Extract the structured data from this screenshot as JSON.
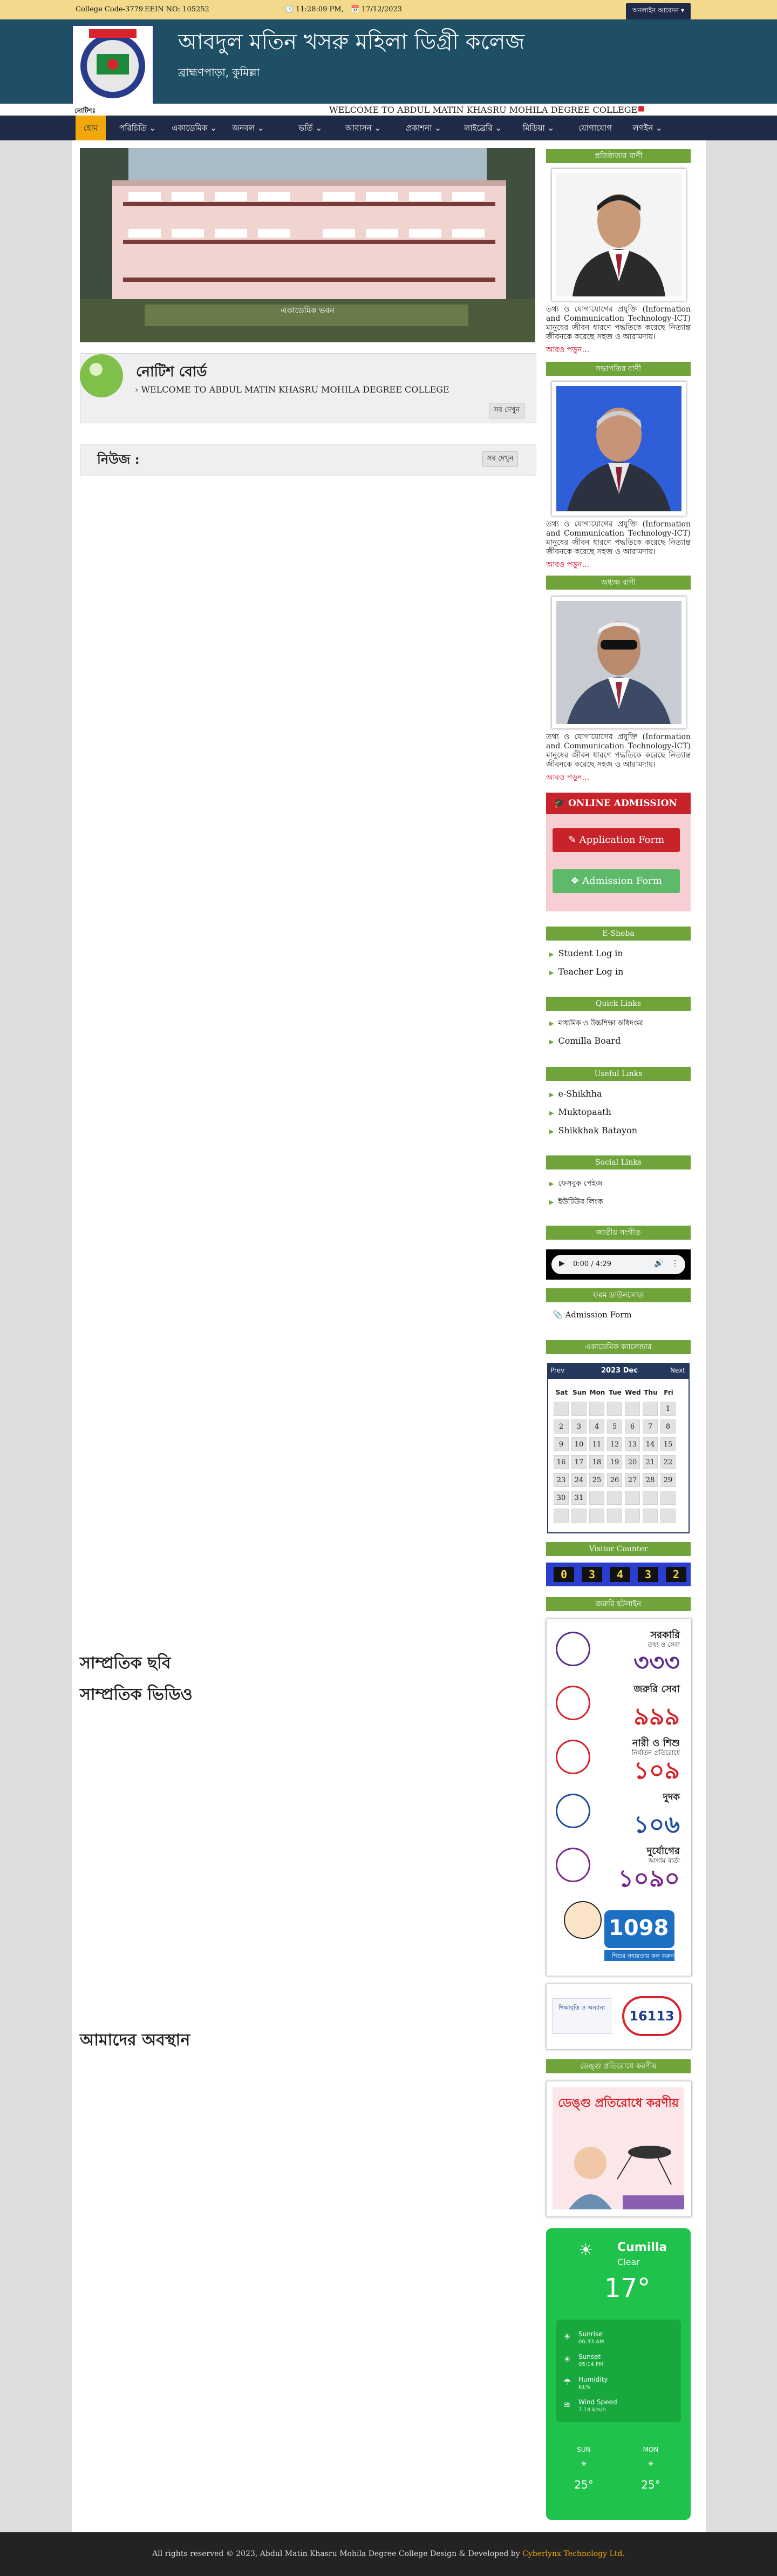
{
  "topbar": {
    "college_code": "College Code-3779",
    "eiin": "EEIN NO: 105252",
    "time": "11:28:09 PM,",
    "date": "17/12/2023",
    "online_apply": "অনলাইন আবেদন"
  },
  "header": {
    "title": "আবদুল মতিন খসরু মহিলা ডিগ্রী কলেজ",
    "location": "ব্রাহ্মণপাড়া, কুমিল্লা"
  },
  "ticker": {
    "label": "নোটিশঃ",
    "text": "WELCOME TO ABDUL MATIN KHASRU MOHILA DEGREE COLLEGE"
  },
  "nav": [
    {
      "label": "হোম"
    },
    {
      "label": "পরিচিতি"
    },
    {
      "label": "একাডেমিক"
    },
    {
      "label": "জনবল"
    },
    {
      "label": "ভর্তি"
    },
    {
      "label": "আবাসন"
    },
    {
      "label": "প্রকাশনা"
    },
    {
      "label": "লাইব্রেরি"
    },
    {
      "label": "মিডিয়া"
    },
    {
      "label": "যোগাযোগ"
    },
    {
      "label": "লগইন"
    }
  ],
  "hero": {
    "caption": "একাডেমিক ভবন"
  },
  "notice_board": {
    "title": "নোটিশ বোর্ড",
    "item": "WELCOME TO ABDUL MATIN KHASRU MOHILA DEGREE COLLEGE",
    "all": "সব দেখুন"
  },
  "news": {
    "title": "নিউজ :",
    "all": "সব দেখুন"
  },
  "sections": {
    "photos": "সাম্প্রতিক ছবি",
    "videos": "সাম্প্রতিক ভিডিও",
    "location": "আমাদের অবস্থান"
  },
  "messages": [
    {
      "heading": "প্রতিষ্ঠাতার বাণী",
      "text": "তথ্য ও যোগাযোগের প্রযুক্তি (Information and Communication Technology-ICT) মানুষের জীবন ধারণে পদ্ধতিকে করেছে নিত্যান্ত জীবনকে করেছে সহজ ও আরামদায়।",
      "more": "আরও পড়ুন...",
      "suit": "#2b2b2b",
      "shirt": "#ffffff",
      "tie": "#a02030",
      "photo_bg": "#f4f4f4"
    },
    {
      "heading": "সভাপতির বাণী",
      "text": "তথ্য ও যোগাযোগের প্রযুক্তি (Information and Communication Technology-ICT) মানুষের জীবন ধারণে পদ্ধতিকে করেছে নিত্যান্ত জীবনকে করেছে সহজ ও আরামদায়।",
      "more": "আরও পড়ুন...",
      "suit": "#2c3140",
      "shirt": "#e8e8e8",
      "tie": "#8a1f3a",
      "photo_bg": "#2f5fd8"
    },
    {
      "heading": "অধ্যক্ষ বাণী",
      "text": "তথ্য ও যোগাযোগের প্রযুক্তি (Information and Communication Technology-ICT) মানুষের জীবন ধারণে পদ্ধতিকে করেছে নিত্যান্ত জীবনকে করেছে সহজ ও আরামদায়।",
      "more": "আরও পড়ুন...",
      "suit": "#3c4a66",
      "shirt": "#ffffff",
      "tie": "#a02a3a",
      "photo_bg": "#c8ccd2"
    }
  ],
  "admission": {
    "title": "ONLINE ADMISSION",
    "application_form": "Application Form",
    "admission_form": "Admission Form"
  },
  "esheba": {
    "title": "E-Sheba",
    "items": [
      "Student Log in",
      "Teacher Log in"
    ]
  },
  "quick_links": {
    "title": "Quick Links",
    "items": [
      "মাধ্যমিক ও উচ্চশিক্ষা অধিদপ্তর",
      "Comilla Board"
    ]
  },
  "useful_links": {
    "title": "Useful Links",
    "items": [
      "e-Shikhha",
      "Muktopaath",
      "Shikkhak Batayon"
    ]
  },
  "social_links": {
    "title": "Social Links",
    "items": [
      "ফেসবুক পেইজ",
      "ইউটিউব লিংক"
    ]
  },
  "anthem": {
    "title": "জাতীয় সংগীত",
    "time": "0:00 / 4:29"
  },
  "downloads": {
    "title": "ফরম ডাউনলোড",
    "item": "Admission Form"
  },
  "calendar": {
    "title": "একাডেমিক ক্যালেন্ডার",
    "prev": "Prev",
    "next": "Next",
    "month": "2023 Dec",
    "weekdays": [
      "Sat",
      "Sun",
      "Mon",
      "Tue",
      "Wed",
      "Thu",
      "Fri"
    ],
    "days": [
      "",
      "",
      "",
      "",
      "",
      "",
      "1",
      "2",
      "3",
      "4",
      "5",
      "6",
      "7",
      "8",
      "9",
      "10",
      "11",
      "12",
      "13",
      "14",
      "15",
      "16",
      "17",
      "18",
      "19",
      "20",
      "21",
      "22",
      "23",
      "24",
      "25",
      "26",
      "27",
      "28",
      "29",
      "30",
      "31",
      "",
      "",
      "",
      "",
      "",
      "",
      "",
      "",
      "",
      "",
      "",
      ""
    ]
  },
  "visitor": {
    "title": "Visitor Counter",
    "digits": [
      "0",
      "3",
      "4",
      "3",
      "2"
    ]
  },
  "hotline": {
    "title": "জরুরি হটলাইন",
    "items": [
      {
        "top": "সরকারি",
        "sub": "তথ্য ও সেবা",
        "num": "৩৩৩",
        "color": "#5a2d8c"
      },
      {
        "top": "জরুরি সেবা",
        "sub": "",
        "num": "৯৯৯",
        "color": "#d8232a"
      },
      {
        "top": "নারী ও শিশু",
        "sub": "নির্যাতন প্রতিরোধে",
        "num": "১০৯",
        "color": "#d8232a"
      },
      {
        "top": "দুদক",
        "sub": "",
        "num": "১০৬",
        "color": "#1f4fa0"
      },
      {
        "top": "দুর্যোগের",
        "sub": "আগাম বার্তা",
        "num": "১০৯০",
        "color": "#7a2a8c"
      }
    ],
    "child_num": "1098",
    "child_caption": "শিশুর সহায়তায় কল করুন"
  },
  "ict": {
    "left": "শিক্ষাবৃত্তি ও অন্যান্য",
    "num": "16113"
  },
  "dengue": {
    "title": "ডেঙ্গু প্রতিরোধে করণীয়",
    "banner": "ডেঙ্গু প্রতিরোধে করণীয়"
  },
  "weather": {
    "city": "Cumilla",
    "cond": "Clear",
    "temp": "17°",
    "rows": [
      {
        "label": "Sunrise",
        "val": "06:33 AM"
      },
      {
        "label": "Sunset",
        "val": "05:14 PM"
      },
      {
        "label": "Humidity",
        "val": "61%"
      },
      {
        "label": "Wind Speed",
        "val": "7.14 km/h"
      }
    ],
    "days": [
      {
        "d": "SUN",
        "t": "25°"
      },
      {
        "d": "MON",
        "t": "25°"
      }
    ]
  },
  "footer": {
    "text": "All rights reserved © 2023, Abdul Matin Khasru Mohila Degree College Design & Developed by",
    "dev": "Cyberlynx Technology Ltd."
  }
}
